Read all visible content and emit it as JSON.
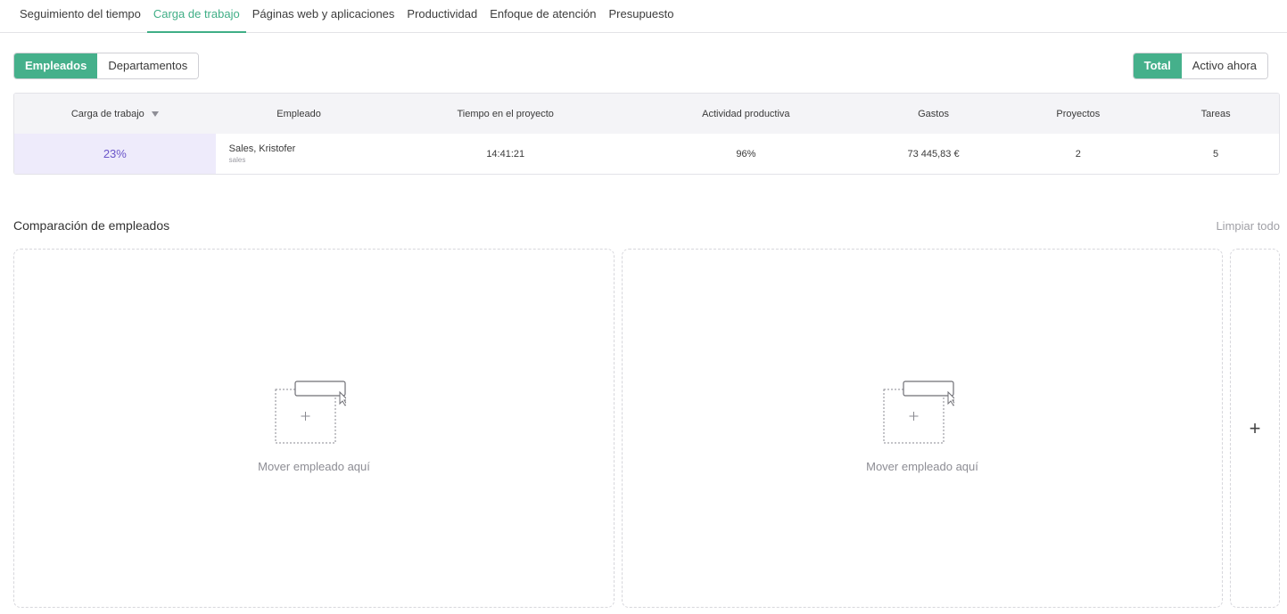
{
  "tabs": [
    {
      "label": "Seguimiento del tiempo"
    },
    {
      "label": "Carga de trabajo"
    },
    {
      "label": "Páginas web y aplicaciones"
    },
    {
      "label": "Productividad"
    },
    {
      "label": "Enfoque de atención"
    },
    {
      "label": "Presupuesto"
    }
  ],
  "active_tab": "Carga de trabajo",
  "view_toggle": {
    "employees": "Empleados",
    "departments": "Departamentos",
    "selected": "Empleados"
  },
  "time_toggle": {
    "total": "Total",
    "active_now": "Activo ahora",
    "selected": "Total"
  },
  "table": {
    "headers": {
      "workload": "Carga de trabajo",
      "employee": "Empleado",
      "time_on_project": "Tiempo en el proyecto",
      "productive_activity": "Actividad productiva",
      "expenses": "Gastos",
      "projects": "Proyectos",
      "tasks": "Tareas"
    },
    "rows": [
      {
        "workload": "23%",
        "employee_name": "Sales, Kristofer",
        "employee_dept": "sales",
        "time_on_project": "14:41:21",
        "productive_activity": "96%",
        "expenses": "73 445,83 €",
        "projects": "2",
        "tasks": "5"
      }
    ]
  },
  "comparison": {
    "title": "Comparación de empleados",
    "clear_label": "Limpiar todo",
    "drop_text": "Mover empleado aquí",
    "add_symbol": "+"
  },
  "colors": {
    "accent": "#45b08b",
    "workload_bg": "#eeebfb",
    "workload_text": "#6a55c9"
  },
  "icons": {
    "sort": "sort-down-icon",
    "drop": "drag-drop-icon",
    "add": "plus-icon"
  }
}
